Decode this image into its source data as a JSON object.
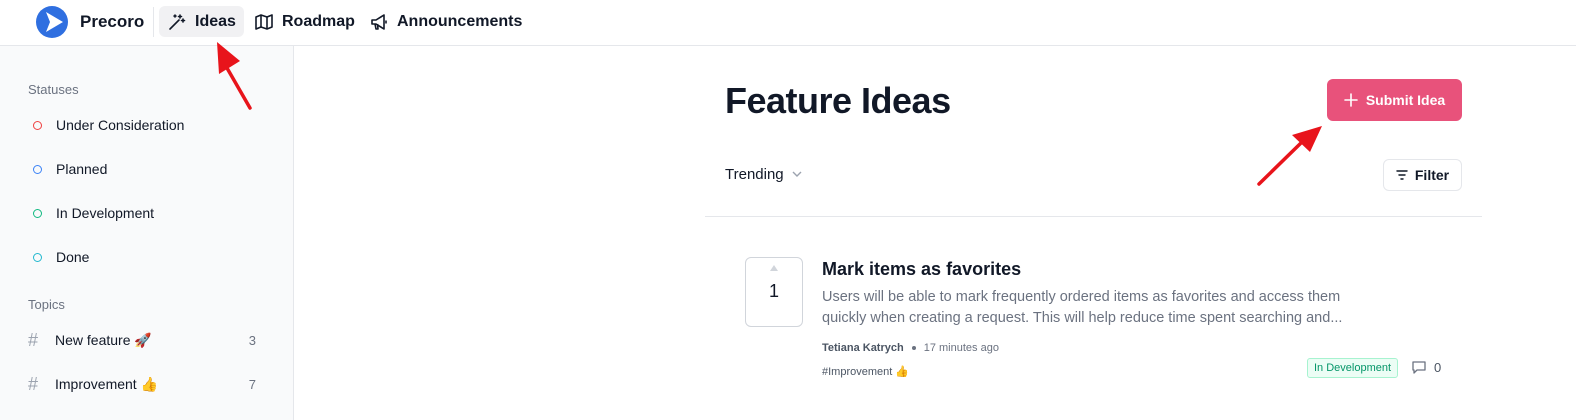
{
  "brand": {
    "name": "Precoro"
  },
  "nav": [
    {
      "label": "Ideas",
      "icon": "magic-wand-icon",
      "active": true
    },
    {
      "label": "Roadmap",
      "icon": "map-icon",
      "active": false
    },
    {
      "label": "Announcements",
      "icon": "megaphone-icon",
      "active": false
    }
  ],
  "sidebar": {
    "statuses_title": "Statuses",
    "statuses": [
      {
        "label": "Under Consideration",
        "color": "#ef4444"
      },
      {
        "label": "Planned",
        "color": "#3b82f6"
      },
      {
        "label": "In Development",
        "color": "#10b981"
      },
      {
        "label": "Done",
        "color": "#22b8cf"
      }
    ],
    "topics_title": "Topics",
    "topics": [
      {
        "label": "New feature 🚀",
        "count": "3"
      },
      {
        "label": "Improvement 👍",
        "count": "7"
      }
    ]
  },
  "main": {
    "title": "Feature Ideas",
    "submit_label": "Submit Idea",
    "sort_label": "Trending",
    "filter_label": "Filter"
  },
  "idea": {
    "votes": "1",
    "title": "Mark items as favorites",
    "description": "Users will be able to mark frequently ordered items as favorites and access them quickly when creating a request. This will help reduce time spent searching and...",
    "author": "Tetiana Katrych",
    "time": "17 minutes ago",
    "tag": "#Improvement 👍",
    "status": "In Development",
    "comments": "0"
  },
  "colors": {
    "accent": "#e8527b",
    "annotation_arrow": "#e8141b"
  }
}
